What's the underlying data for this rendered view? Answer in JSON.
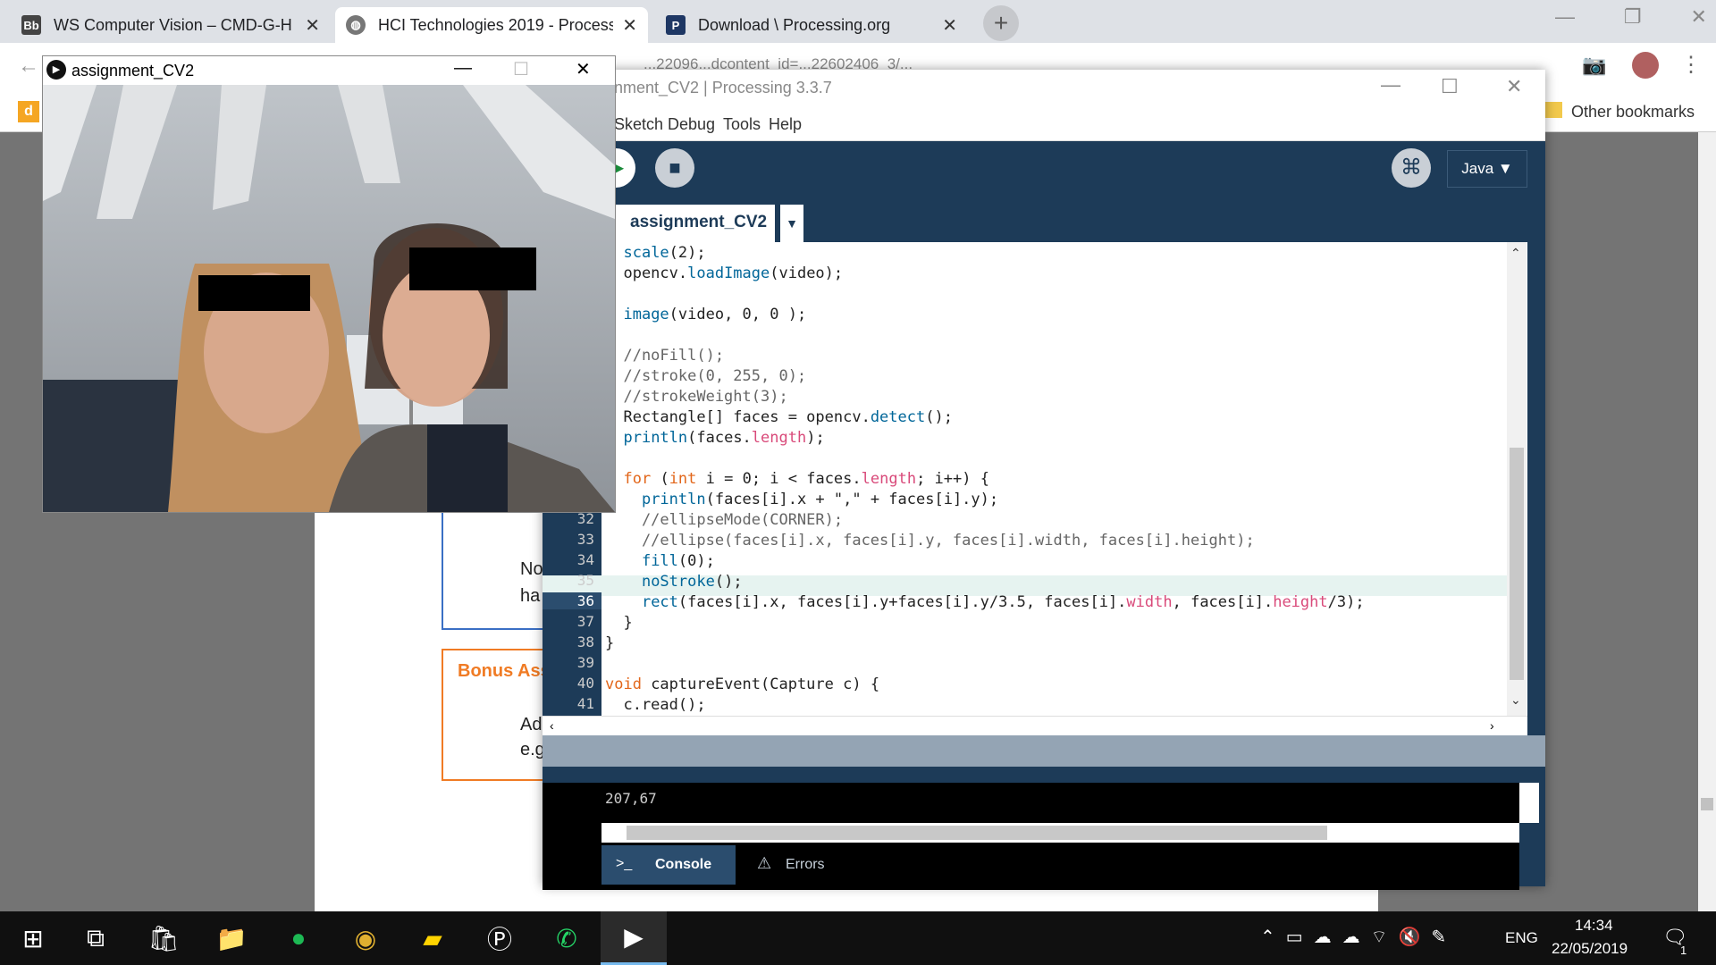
{
  "browser": {
    "tabs": [
      {
        "label": "WS Computer Vision – CMD-G-H",
        "icon": "Bb"
      },
      {
        "label": "HCI Technologies 2019 - Process",
        "icon": "globe"
      },
      {
        "label": "Download \\ Processing.org",
        "icon": "P"
      }
    ],
    "url_fragment": "...22096...dcontent_id=...22602406_3/...",
    "bookmarks_label": "Other bookmarks"
  },
  "document": {
    "text1": "No",
    "text2": "ha",
    "bonus": "Bonus Ass",
    "text3": "Ad",
    "text4": "e.g"
  },
  "cv_window": {
    "title": "assignment_CV2"
  },
  "processing": {
    "title": "nment_CV2 | Processing 3.3.7",
    "menu": [
      "Sketch",
      "Debug",
      "Tools",
      "Help"
    ],
    "mode": "Java ▼",
    "tab": "assignment_CV2",
    "console_output": "207,67",
    "console_tab": "Console",
    "errors_tab": "Errors"
  },
  "code_lines": [
    {
      "n": "",
      "t": "  scale(2);"
    },
    {
      "n": "",
      "t": "  opencv.loadImage(video);"
    },
    {
      "n": "",
      "t": ""
    },
    {
      "n": "",
      "t": "  image(video, 0, 0 );"
    },
    {
      "n": "",
      "t": ""
    },
    {
      "n": "",
      "t": "  //noFill();"
    },
    {
      "n": "",
      "t": "  //stroke(0, 255, 0);"
    },
    {
      "n": "",
      "t": "  //strokeWeight(3);"
    },
    {
      "n": "",
      "t": "  Rectangle[] faces = opencv.detect();"
    },
    {
      "n": "",
      "t": "  println(faces.length);"
    },
    {
      "n": "",
      "t": ""
    },
    {
      "n": "",
      "t": "  for (int i = 0; i < faces.length; i++) {"
    },
    {
      "n": "",
      "t": "    println(faces[i].x + \",\" + faces[i].y);"
    },
    {
      "n": "32",
      "t": "    //ellipseMode(CORNER);"
    },
    {
      "n": "33",
      "t": "    //ellipse(faces[i].x, faces[i].y, faces[i].width, faces[i].height);"
    },
    {
      "n": "34",
      "t": "    fill(0);"
    },
    {
      "n": "35",
      "t": "    noStroke();"
    },
    {
      "n": "36",
      "t": "    rect(faces[i].x, faces[i].y+faces[i].y/3.5, faces[i].width, faces[i].height/3);"
    },
    {
      "n": "37",
      "t": "  }"
    },
    {
      "n": "38",
      "t": "}"
    },
    {
      "n": "39",
      "t": ""
    },
    {
      "n": "40",
      "t": "void captureEvent(Capture c) {"
    },
    {
      "n": "41",
      "t": "  c.read();"
    }
  ],
  "taskbar": {
    "lang": "ENG",
    "time": "14:34",
    "date": "22/05/2019",
    "notif": "1"
  }
}
